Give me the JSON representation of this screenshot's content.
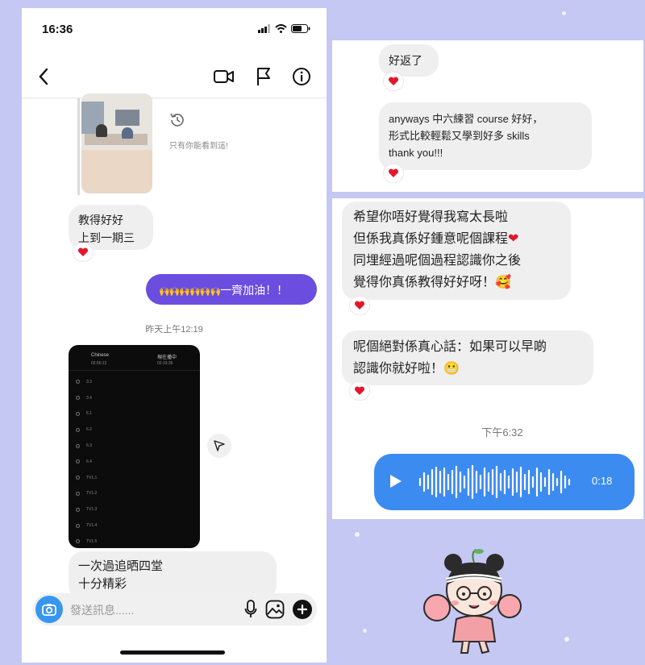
{
  "phone": {
    "status_time": "16:36",
    "seen_note": "只有你能看到這!",
    "msg_teach": [
      "教得好好",
      "上到一期三"
    ],
    "msg_outgoing": "一齊加油！！",
    "timestamp_1": "昨天上午12:19",
    "dark_header": {
      "col1": "Chinese",
      "col2": "現在播中",
      "sub1": "02:56:12",
      "sub2": "02:33:36"
    },
    "dark_items": [
      "3.3",
      "3.4",
      "6.1",
      "6.2",
      "6.3",
      "6.4",
      "TV1.1",
      "TV1.2",
      "TV1.3",
      "TV1.4",
      "TV1.5"
    ],
    "msg_binge": [
      "一次過追晒四堂",
      "十分精彩"
    ],
    "composer_placeholder": "發送訊息......"
  },
  "panel_top": {
    "msg_back": "好返了",
    "msg_anyways": [
      "anyways 中六練習 course 好好，",
      "形式比較輕鬆又學到好多 skills",
      "thank you!!!"
    ]
  },
  "panel_mid": {
    "msg_long": [
      "希望你唔好覺得我寫太長啦",
      "但係我真係好鍾意呢個課程",
      "同埋經過呢個過程認識你之後",
      "覺得你真係教得好好呀！"
    ],
    "msg_sincere": [
      "呢個絕對係真心話：如果可以早啲",
      "認識你就好啦！"
    ],
    "timestamp": "下午6:32",
    "voice_duration": "0:18"
  },
  "colors": {
    "outgoing_bubble": "#6b4de0",
    "voice_bubble": "#3c8bf0",
    "heart": "#e0182d",
    "background": "#c4c8f2"
  },
  "icons": [
    "back-icon",
    "video-call-icon",
    "flag-icon",
    "info-icon",
    "camera-icon",
    "microphone-icon",
    "gallery-icon",
    "add-icon",
    "share-icon",
    "play-icon"
  ]
}
